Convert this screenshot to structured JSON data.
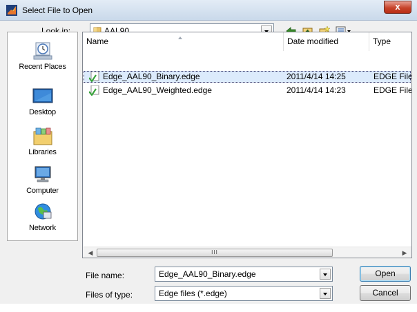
{
  "window": {
    "title": "Select File to Open",
    "close_glyph": "x"
  },
  "toolbar": {
    "look_in_label": "Look in:",
    "look_in_value": "AAL90",
    "icons": [
      "back-arrow-icon",
      "up-folder-icon",
      "new-folder-icon",
      "view-menu-icon"
    ]
  },
  "places": [
    {
      "label": "Recent Places",
      "icon": "recent-places-icon"
    },
    {
      "label": "Desktop",
      "icon": "desktop-icon"
    },
    {
      "label": "Libraries",
      "icon": "libraries-icon"
    },
    {
      "label": "Computer",
      "icon": "computer-icon"
    },
    {
      "label": "Network",
      "icon": "network-icon"
    }
  ],
  "columns": [
    "Name",
    "Date modified",
    "Type"
  ],
  "files": [
    {
      "name": "Edge_AAL90_Binary.edge",
      "date": "2011/4/14 14:25",
      "type": "EDGE File",
      "selected": true
    },
    {
      "name": "Edge_AAL90_Weighted.edge",
      "date": "2011/4/14 14:23",
      "type": "EDGE File",
      "selected": false
    }
  ],
  "scrollbar": {
    "thumb_grip": "III"
  },
  "form": {
    "file_name_label": "File name:",
    "file_name_value": "Edge_AAL90_Binary.edge",
    "file_type_label": "Files of type:",
    "file_type_value": "Edge files (*.edge)"
  },
  "buttons": {
    "open": "Open",
    "cancel": "Cancel"
  },
  "colors": {
    "selection": "#dcebfc",
    "title_bar": "#c9d9ea",
    "close_button": "#c7442b"
  }
}
